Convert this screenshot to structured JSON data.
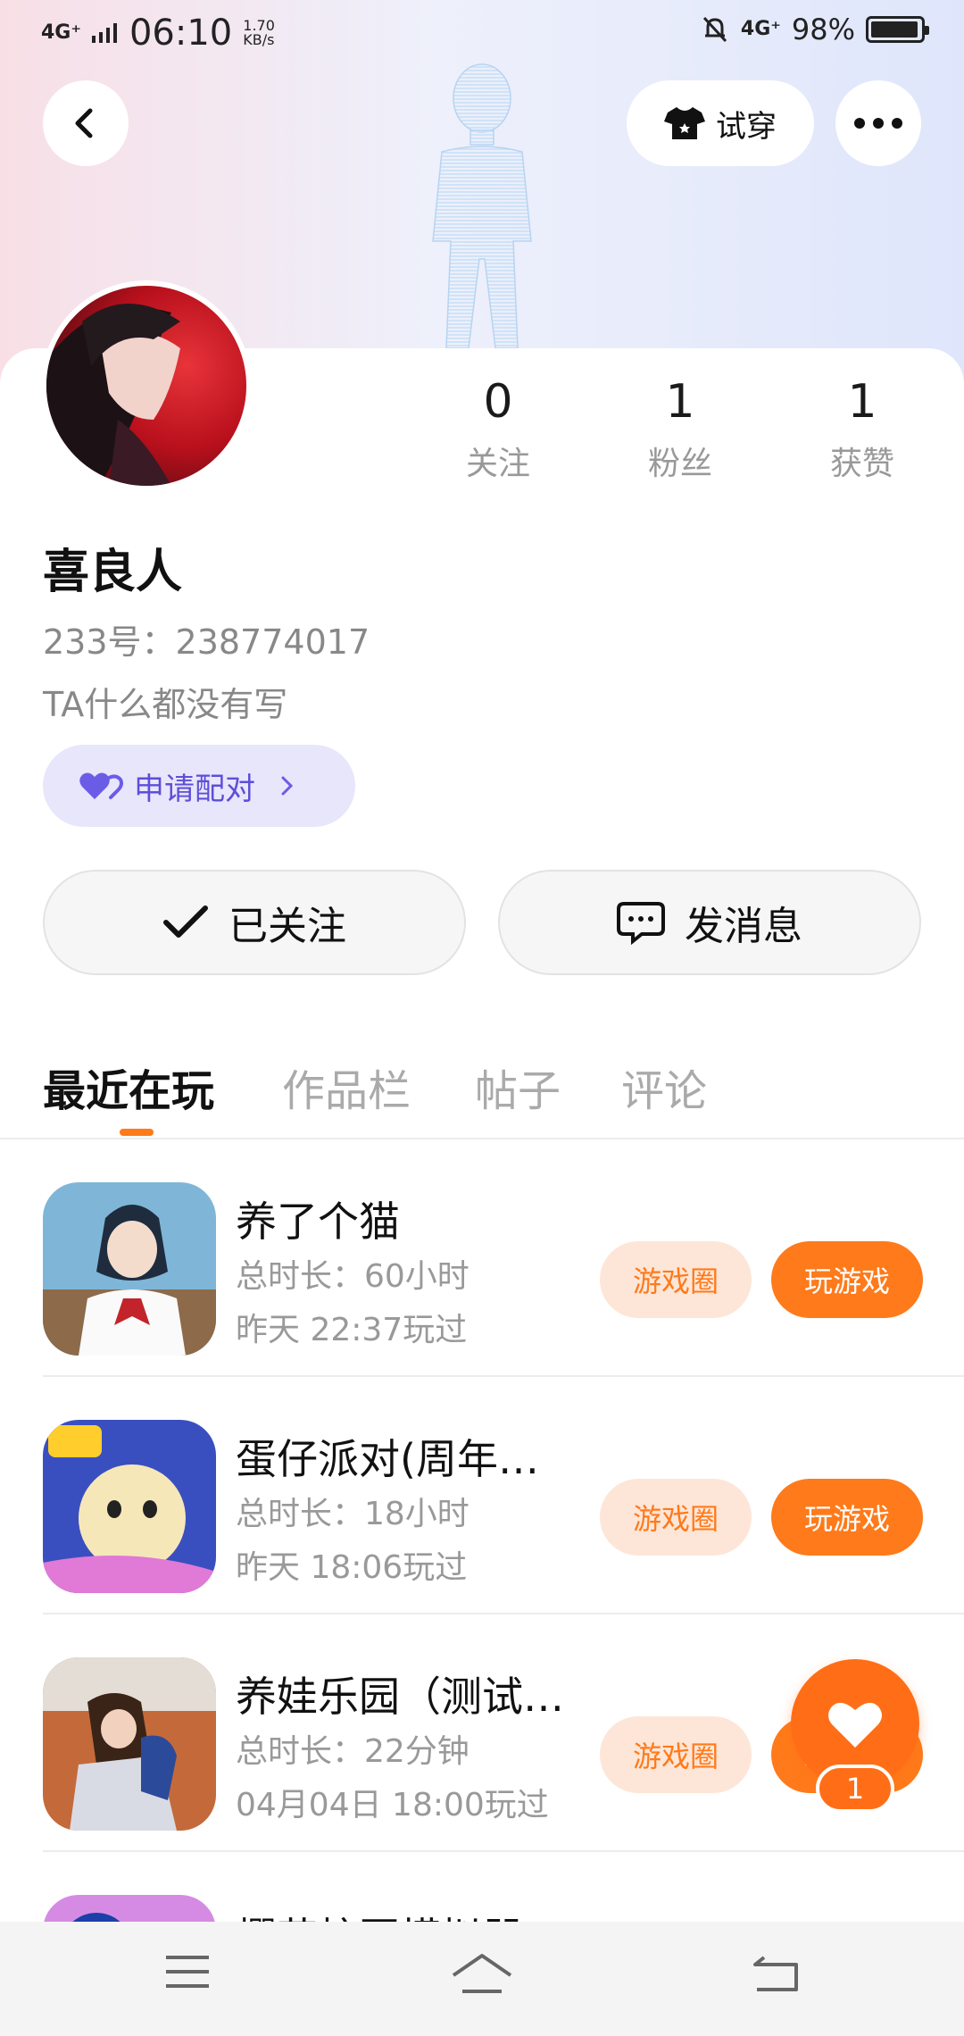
{
  "status_bar": {
    "network": "4G⁺",
    "time": "06:10",
    "speed_value": "1.70",
    "speed_unit": "KB/s",
    "network_right": "4G⁺",
    "battery": "98%"
  },
  "header": {
    "try_on_label": "试穿"
  },
  "profile": {
    "stats": [
      {
        "value": "0",
        "label": "关注"
      },
      {
        "value": "1",
        "label": "粉丝"
      },
      {
        "value": "1",
        "label": "获赞"
      }
    ],
    "name": "喜良人",
    "uid": "233号：238774017",
    "bio": "TA什么都没有写",
    "pair_label": "申请配对"
  },
  "actions": {
    "followed_label": "已关注",
    "message_label": "发消息"
  },
  "tabs": [
    "最近在玩",
    "作品栏",
    "帖子",
    "评论"
  ],
  "games": [
    {
      "title": "养了个猫",
      "duration": "总时长：60小时",
      "last_played": "昨天 22:37玩过",
      "circle_label": "游戏圈",
      "play_label": "玩游戏"
    },
    {
      "title": "蛋仔派对(周年…",
      "duration": "总时长：18小时",
      "last_played": "昨天 18:06玩过",
      "circle_label": "游戏圈",
      "play_label": "玩游戏"
    },
    {
      "title": "养娃乐园（测试…",
      "duration": "总时长：22分钟",
      "last_played": "04月04日 18:00玩过",
      "circle_label": "游戏圈",
      "play_label": "玩游戏"
    },
    {
      "title": "樱花校园模拟器",
      "duration": "",
      "last_played": "",
      "circle_label": "",
      "play_label": ""
    }
  ],
  "fab": {
    "count": "1"
  },
  "colors": {
    "accent": "#ff7a1a",
    "pair_bg": "#e8e6fb",
    "pair_text": "#5d4fd8"
  }
}
